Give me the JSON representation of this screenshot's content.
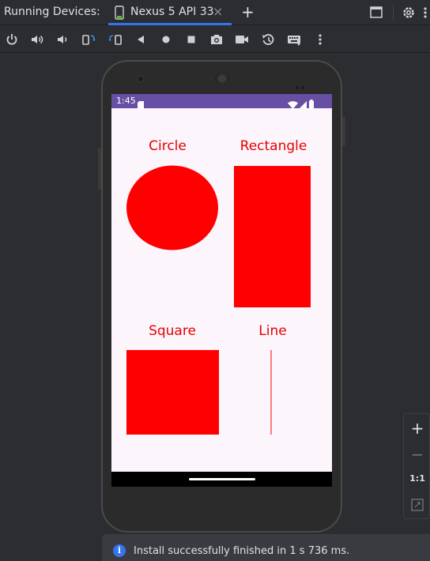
{
  "tabbar": {
    "title": "Running Devices:",
    "tab_label": "Nexus 5 API 33",
    "close_glyph": "×",
    "add_glyph": "+"
  },
  "toolbar": {
    "icons": [
      "power-icon",
      "volume-up-icon",
      "volume-down-icon",
      "rotate-left-icon",
      "rotate-right-icon",
      "back-icon",
      "home-icon",
      "overview-icon",
      "screenshot-icon",
      "screen-record-icon",
      "snapshot-icon",
      "keyboard-icon",
      "more-icon"
    ]
  },
  "device": {
    "status_time": "1:45",
    "statusbar_color": "#6750a4",
    "background_color": "#fcf6fc"
  },
  "shapes": {
    "color": "#ff0000",
    "label_color": "#e50000",
    "circle_label": "Circle",
    "rectangle_label": "Rectangle",
    "square_label": "Square",
    "line_label": "Line"
  },
  "zoom": {
    "zoom_in": "+",
    "zoom_out": "−",
    "actual_size": "1:1"
  },
  "notification": {
    "icon_glyph": "i",
    "text": "Install successfully finished in 1 s 736 ms."
  },
  "colors": {
    "accent": "#3574f0",
    "ide_background": "#2b2d30"
  }
}
